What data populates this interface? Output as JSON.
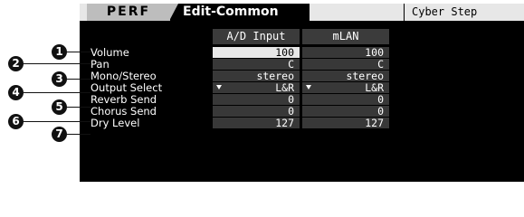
{
  "header": {
    "mode": "PERF",
    "page": "Edit-Common",
    "performance_name": "Cyber Step"
  },
  "columns": [
    "A/D Input",
    "mLAN"
  ],
  "rows": [
    {
      "callout": "1",
      "label": "Volume",
      "ad": "100",
      "mlan": "100"
    },
    {
      "callout": "2",
      "label": "Pan",
      "ad": "C",
      "mlan": "C"
    },
    {
      "callout": "3",
      "label": "Mono/Stereo",
      "ad": "stereo",
      "mlan": "stereo"
    },
    {
      "callout": "4",
      "label": "Output Select",
      "ad": "L&R",
      "mlan": "L&R",
      "dropdown": true
    },
    {
      "callout": "5",
      "label": "Reverb Send",
      "ad": "0",
      "mlan": "0"
    },
    {
      "callout": "6",
      "label": "Chorus Send",
      "ad": "0",
      "mlan": "0"
    },
    {
      "callout": "7",
      "label": "Dry Level",
      "ad": "127",
      "mlan": "127"
    }
  ],
  "colors": {
    "screen": "#000000",
    "selected_cell": "#e8e8e8",
    "cell": "#383838",
    "header_bar": "#e7e7e7"
  },
  "icons": {
    "dropdown": "triangle-down-icon"
  }
}
